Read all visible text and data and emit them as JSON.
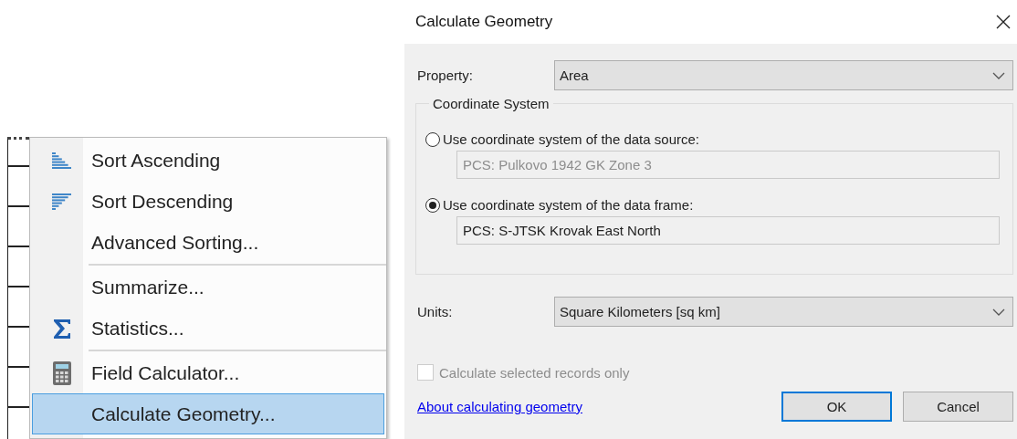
{
  "context_menu": {
    "groups": [
      {
        "items": [
          {
            "label": "Sort Ascending",
            "kind": "ascending",
            "selected": false
          },
          {
            "label": "Sort Descending",
            "kind": "descending",
            "selected": false
          },
          {
            "label": "Advanced Sorting...",
            "kind": "plain",
            "selected": false
          }
        ]
      },
      {
        "items": [
          {
            "label": "Summarize...",
            "kind": "plain",
            "selected": false
          },
          {
            "label": "Statistics...",
            "kind": "sum",
            "selected": false
          }
        ]
      },
      {
        "items": [
          {
            "label": "Field Calculator...",
            "kind": "calculator",
            "selected": false
          },
          {
            "label": "Calculate Geometry...",
            "kind": "plain",
            "selected": true
          }
        ]
      }
    ]
  },
  "dialog": {
    "title": "Calculate Geometry",
    "property": {
      "label": "Property:",
      "value": "Area"
    },
    "coordinate_system": {
      "title": "Coordinate System",
      "options": [
        {
          "label": "Use coordinate system of the data source:",
          "value": "PCS: Pulkovo 1942 GK Zone 3",
          "selected": false
        },
        {
          "label": "Use coordinate system of the data frame:",
          "value": "PCS: S-JTSK Krovak East North",
          "selected": true
        }
      ]
    },
    "units": {
      "label": "Units:",
      "value": "Square Kilometers [sq km]"
    },
    "selected_only": {
      "label": "Calculate selected records only",
      "checked": false,
      "disabled": true
    },
    "help_link": "About calculating geometry",
    "buttons": [
      {
        "label": "OK",
        "default": true
      },
      {
        "label": "Cancel",
        "default": false
      }
    ]
  }
}
